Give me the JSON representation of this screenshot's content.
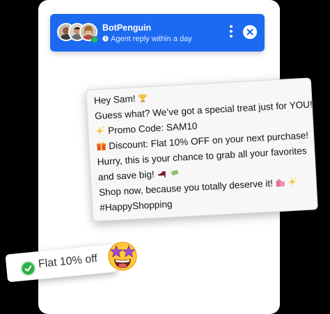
{
  "header": {
    "bot_name": "BotPenguin",
    "status": "Agent reply within a day",
    "avatars": [
      "agent-avatar-1",
      "agent-avatar-2",
      "agent-avatar-3"
    ]
  },
  "message": {
    "lines": [
      "Hey Sam!",
      "Guess what? We’ve got a special treat just for YOU!",
      "Promo Code: SAM10",
      "Discount: Flat 10% OFF on your next purchase!",
      "Hurry, this is your chance to grab all your favorites",
      "and save big!",
      "Shop now, because you totally deserve it!",
      "#HappyShopping"
    ]
  },
  "offer": {
    "label": "Flat 10% off"
  },
  "colors": {
    "header": "#1d6af2",
    "check": "#2bb24c",
    "online": "#23c04a"
  }
}
